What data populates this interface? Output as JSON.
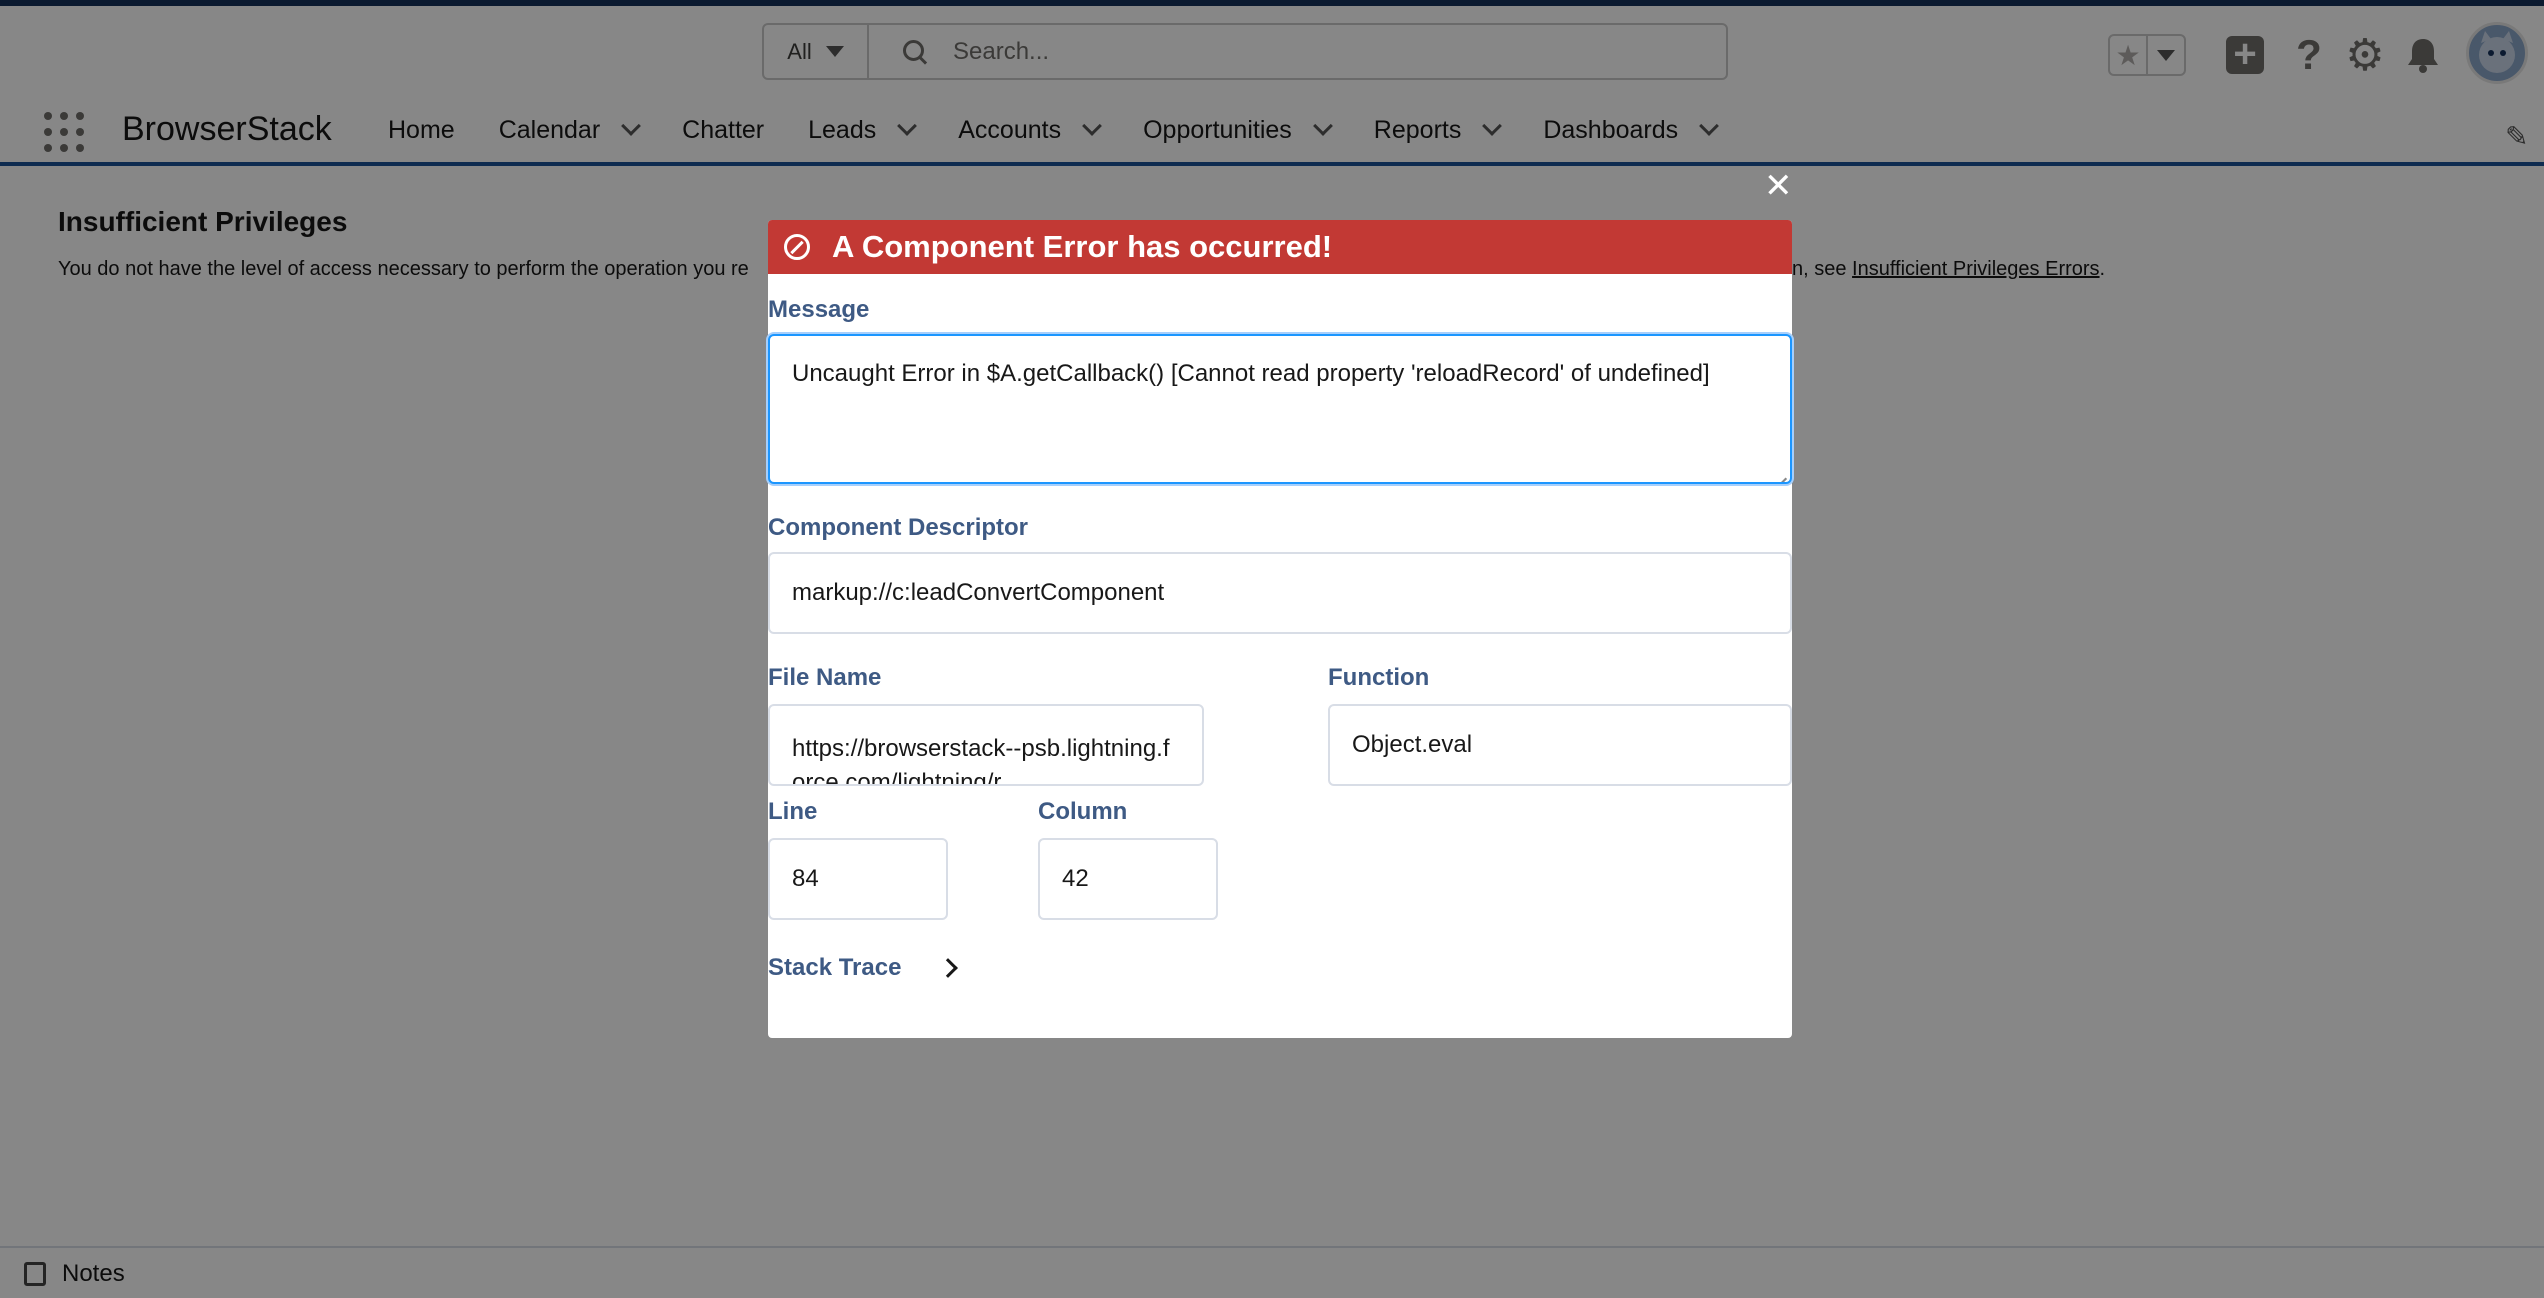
{
  "header": {
    "search_scope": "All",
    "search_placeholder": "Search...",
    "icons": [
      "favorites-star-icon",
      "add-icon",
      "help-icon",
      "setup-gear-icon",
      "notifications-bell-icon",
      "user-avatar"
    ]
  },
  "nav": {
    "app_name": "BrowserStack",
    "items": [
      {
        "label": "Home",
        "dropdown": false
      },
      {
        "label": "Calendar",
        "dropdown": true
      },
      {
        "label": "Chatter",
        "dropdown": false
      },
      {
        "label": "Leads",
        "dropdown": true
      },
      {
        "label": "Accounts",
        "dropdown": true
      },
      {
        "label": "Opportunities",
        "dropdown": true
      },
      {
        "label": "Reports",
        "dropdown": true
      },
      {
        "label": "Dashboards",
        "dropdown": true
      }
    ]
  },
  "page": {
    "title": "Insufficient Privileges",
    "message_start": "You do not have the level of access necessary to perform the operation you re",
    "message_end_prefix": "n, see ",
    "message_link": "Insufficient Privileges Errors",
    "message_end_suffix": "."
  },
  "modal": {
    "title": "A Component Error has occurred!",
    "message_label": "Message",
    "message_value": "Uncaught Error in $A.getCallback() [Cannot read property 'reloadRecord' of undefined]",
    "descriptor_label": "Component Descriptor",
    "descriptor_value": "markup://c:leadConvertComponent",
    "file_label": "File Name",
    "file_value": "https://browserstack--psb.lightning.force.com/lightning/r",
    "function_label": "Function",
    "function_value": "Object.eval",
    "line_label": "Line",
    "line_value": "84",
    "column_label": "Column",
    "column_value": "42",
    "stack_label": "Stack Trace"
  },
  "footer": {
    "notes_label": "Notes"
  },
  "colors": {
    "error_header": "#c23934",
    "nav_border": "#1b5297",
    "label_blue": "#3e5a84",
    "focus_border": "#1b96ff"
  }
}
